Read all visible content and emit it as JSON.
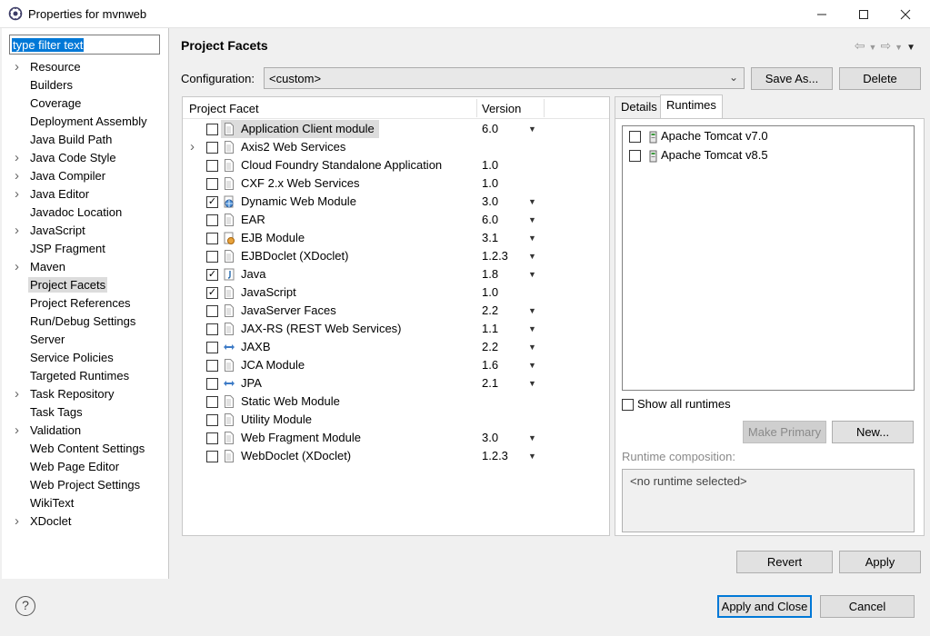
{
  "window": {
    "title": "Properties for mvnweb"
  },
  "nav": {
    "filter_placeholder": "type filter text",
    "items": [
      {
        "label": "Resource",
        "expandable": true
      },
      {
        "label": "Builders",
        "expandable": false
      },
      {
        "label": "Coverage",
        "expandable": false
      },
      {
        "label": "Deployment Assembly",
        "expandable": false
      },
      {
        "label": "Java Build Path",
        "expandable": false
      },
      {
        "label": "Java Code Style",
        "expandable": true
      },
      {
        "label": "Java Compiler",
        "expandable": true
      },
      {
        "label": "Java Editor",
        "expandable": true
      },
      {
        "label": "Javadoc Location",
        "expandable": false
      },
      {
        "label": "JavaScript",
        "expandable": true
      },
      {
        "label": "JSP Fragment",
        "expandable": false
      },
      {
        "label": "Maven",
        "expandable": true
      },
      {
        "label": "Project Facets",
        "expandable": false,
        "selected": true
      },
      {
        "label": "Project References",
        "expandable": false
      },
      {
        "label": "Run/Debug Settings",
        "expandable": false
      },
      {
        "label": "Server",
        "expandable": false
      },
      {
        "label": "Service Policies",
        "expandable": false
      },
      {
        "label": "Targeted Runtimes",
        "expandable": false
      },
      {
        "label": "Task Repository",
        "expandable": true
      },
      {
        "label": "Task Tags",
        "expandable": false
      },
      {
        "label": "Validation",
        "expandable": true
      },
      {
        "label": "Web Content Settings",
        "expandable": false
      },
      {
        "label": "Web Page Editor",
        "expandable": false
      },
      {
        "label": "Web Project Settings",
        "expandable": false
      },
      {
        "label": "WikiText",
        "expandable": false
      },
      {
        "label": "XDoclet",
        "expandable": true
      }
    ]
  },
  "main": {
    "heading": "Project Facets",
    "configuration_label": "Configuration:",
    "configuration_value": "<custom>",
    "save_as_label": "Save As...",
    "delete_label": "Delete",
    "table": {
      "col_facet": "Project Facet",
      "col_version": "Version",
      "rows": [
        {
          "name": "Application Client module",
          "version": "6.0",
          "checked": false,
          "dropdown": true,
          "selected": true,
          "expandable": false,
          "icon": "doc"
        },
        {
          "name": "Axis2 Web Services",
          "version": "",
          "checked": false,
          "dropdown": false,
          "expandable": true,
          "icon": "doc"
        },
        {
          "name": "Cloud Foundry Standalone Application",
          "version": "1.0",
          "checked": false,
          "dropdown": false,
          "expandable": false,
          "icon": "doc"
        },
        {
          "name": "CXF 2.x Web Services",
          "version": "1.0",
          "checked": false,
          "dropdown": false,
          "expandable": false,
          "icon": "doc"
        },
        {
          "name": "Dynamic Web Module",
          "version": "3.0",
          "checked": true,
          "dropdown": true,
          "expandable": false,
          "icon": "globe"
        },
        {
          "name": "EAR",
          "version": "6.0",
          "checked": false,
          "dropdown": true,
          "expandable": false,
          "icon": "doc"
        },
        {
          "name": "EJB Module",
          "version": "3.1",
          "checked": false,
          "dropdown": true,
          "expandable": false,
          "icon": "bean"
        },
        {
          "name": "EJBDoclet (XDoclet)",
          "version": "1.2.3",
          "checked": false,
          "dropdown": true,
          "expandable": false,
          "icon": "doc"
        },
        {
          "name": "Java",
          "version": "1.8",
          "checked": true,
          "dropdown": true,
          "expandable": false,
          "icon": "java"
        },
        {
          "name": "JavaScript",
          "version": "1.0",
          "checked": true,
          "dropdown": false,
          "expandable": false,
          "icon": "doc"
        },
        {
          "name": "JavaServer Faces",
          "version": "2.2",
          "checked": false,
          "dropdown": true,
          "expandable": false,
          "icon": "doc"
        },
        {
          "name": "JAX-RS (REST Web Services)",
          "version": "1.1",
          "checked": false,
          "dropdown": true,
          "expandable": false,
          "icon": "doc"
        },
        {
          "name": "JAXB",
          "version": "2.2",
          "checked": false,
          "dropdown": true,
          "expandable": false,
          "icon": "arrows"
        },
        {
          "name": "JCA Module",
          "version": "1.6",
          "checked": false,
          "dropdown": true,
          "expandable": false,
          "icon": "doc"
        },
        {
          "name": "JPA",
          "version": "2.1",
          "checked": false,
          "dropdown": true,
          "expandable": false,
          "icon": "arrows"
        },
        {
          "name": "Static Web Module",
          "version": "",
          "checked": false,
          "dropdown": false,
          "expandable": false,
          "icon": "doc"
        },
        {
          "name": "Utility Module",
          "version": "",
          "checked": false,
          "dropdown": false,
          "expandable": false,
          "icon": "doc"
        },
        {
          "name": "Web Fragment Module",
          "version": "3.0",
          "checked": false,
          "dropdown": true,
          "expandable": false,
          "icon": "doc"
        },
        {
          "name": "WebDoclet (XDoclet)",
          "version": "1.2.3",
          "checked": false,
          "dropdown": true,
          "expandable": false,
          "icon": "doc"
        }
      ]
    },
    "tabs": {
      "details": "Details",
      "runtimes": "Runtimes"
    },
    "runtimes": [
      {
        "name": "Apache Tomcat v7.0",
        "checked": false
      },
      {
        "name": "Apache Tomcat v8.5",
        "checked": false
      }
    ],
    "show_all_runtimes": "Show all runtimes",
    "make_primary_label": "Make Primary",
    "new_label": "New...",
    "runtime_composition_label": "Runtime composition:",
    "runtime_composition_value": "<no runtime selected>",
    "revert_label": "Revert",
    "apply_label": "Apply"
  },
  "footer": {
    "apply_close_label": "Apply and Close",
    "cancel_label": "Cancel"
  }
}
